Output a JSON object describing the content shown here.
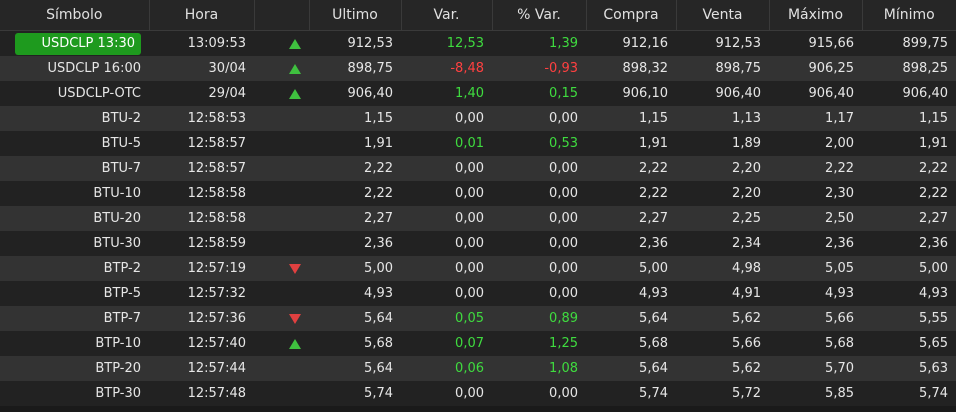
{
  "headers": [
    "Símbolo",
    "Hora",
    "",
    "Ultimo",
    "Var.",
    "% Var.",
    "Compra",
    "Venta",
    "Máximo",
    "Mínimo"
  ],
  "colors": {
    "positive": "#3fdc3f",
    "negative": "#ff4040",
    "neutral": "#e6e6e6",
    "highlight": "#1e9a1e",
    "up_arrow": "#3fc03f",
    "down_arrow": "#e04040"
  },
  "rows": [
    {
      "symbol": "USDCLP 13:30",
      "time": "13:09:53",
      "dir": "up",
      "last": "912,53",
      "var": "12,53",
      "pvar": "1,39",
      "trend": "pos",
      "bid": "912,16",
      "ask": "912,53",
      "high": "915,66",
      "low": "899,75",
      "highlighted": true
    },
    {
      "symbol": "USDCLP 16:00",
      "time": "30/04",
      "dir": "up",
      "last": "898,75",
      "var": "-8,48",
      "pvar": "-0,93",
      "trend": "neg",
      "bid": "898,32",
      "ask": "898,75",
      "high": "906,25",
      "low": "898,25"
    },
    {
      "symbol": "USDCLP-OTC",
      "time": "29/04",
      "dir": "up",
      "last": "906,40",
      "var": "1,40",
      "pvar": "0,15",
      "trend": "pos",
      "bid": "906,10",
      "ask": "906,40",
      "high": "906,40",
      "low": "906,40"
    },
    {
      "symbol": "BTU-2",
      "time": "12:58:53",
      "dir": "",
      "last": "1,15",
      "var": "0,00",
      "pvar": "0,00",
      "trend": "flat",
      "bid": "1,15",
      "ask": "1,13",
      "high": "1,17",
      "low": "1,15"
    },
    {
      "symbol": "BTU-5",
      "time": "12:58:57",
      "dir": "",
      "last": "1,91",
      "var": "0,01",
      "pvar": "0,53",
      "trend": "pos",
      "bid": "1,91",
      "ask": "1,89",
      "high": "2,00",
      "low": "1,91"
    },
    {
      "symbol": "BTU-7",
      "time": "12:58:57",
      "dir": "",
      "last": "2,22",
      "var": "0,00",
      "pvar": "0,00",
      "trend": "flat",
      "bid": "2,22",
      "ask": "2,20",
      "high": "2,22",
      "low": "2,22"
    },
    {
      "symbol": "BTU-10",
      "time": "12:58:58",
      "dir": "",
      "last": "2,22",
      "var": "0,00",
      "pvar": "0,00",
      "trend": "flat",
      "bid": "2,22",
      "ask": "2,20",
      "high": "2,30",
      "low": "2,22"
    },
    {
      "symbol": "BTU-20",
      "time": "12:58:58",
      "dir": "",
      "last": "2,27",
      "var": "0,00",
      "pvar": "0,00",
      "trend": "flat",
      "bid": "2,27",
      "ask": "2,25",
      "high": "2,50",
      "low": "2,27"
    },
    {
      "symbol": "BTU-30",
      "time": "12:58:59",
      "dir": "",
      "last": "2,36",
      "var": "0,00",
      "pvar": "0,00",
      "trend": "flat",
      "bid": "2,36",
      "ask": "2,34",
      "high": "2,36",
      "low": "2,36"
    },
    {
      "symbol": "BTP-2",
      "time": "12:57:19",
      "dir": "down",
      "last": "5,00",
      "var": "0,00",
      "pvar": "0,00",
      "trend": "flat",
      "bid": "5,00",
      "ask": "4,98",
      "high": "5,05",
      "low": "5,00"
    },
    {
      "symbol": "BTP-5",
      "time": "12:57:32",
      "dir": "",
      "last": "4,93",
      "var": "0,00",
      "pvar": "0,00",
      "trend": "flat",
      "bid": "4,93",
      "ask": "4,91",
      "high": "4,93",
      "low": "4,93"
    },
    {
      "symbol": "BTP-7",
      "time": "12:57:36",
      "dir": "down",
      "last": "5,64",
      "var": "0,05",
      "pvar": "0,89",
      "trend": "pos",
      "bid": "5,64",
      "ask": "5,62",
      "high": "5,66",
      "low": "5,55"
    },
    {
      "symbol": "BTP-10",
      "time": "12:57:40",
      "dir": "up",
      "last": "5,68",
      "var": "0,07",
      "pvar": "1,25",
      "trend": "pos",
      "bid": "5,68",
      "ask": "5,66",
      "high": "5,68",
      "low": "5,65"
    },
    {
      "symbol": "BTP-20",
      "time": "12:57:44",
      "dir": "",
      "last": "5,64",
      "var": "0,06",
      "pvar": "1,08",
      "trend": "pos",
      "bid": "5,64",
      "ask": "5,62",
      "high": "5,70",
      "low": "5,63"
    },
    {
      "symbol": "BTP-30",
      "time": "12:57:48",
      "dir": "",
      "last": "5,74",
      "var": "0,00",
      "pvar": "0,00",
      "trend": "flat",
      "bid": "5,74",
      "ask": "5,72",
      "high": "5,85",
      "low": "5,74"
    }
  ]
}
